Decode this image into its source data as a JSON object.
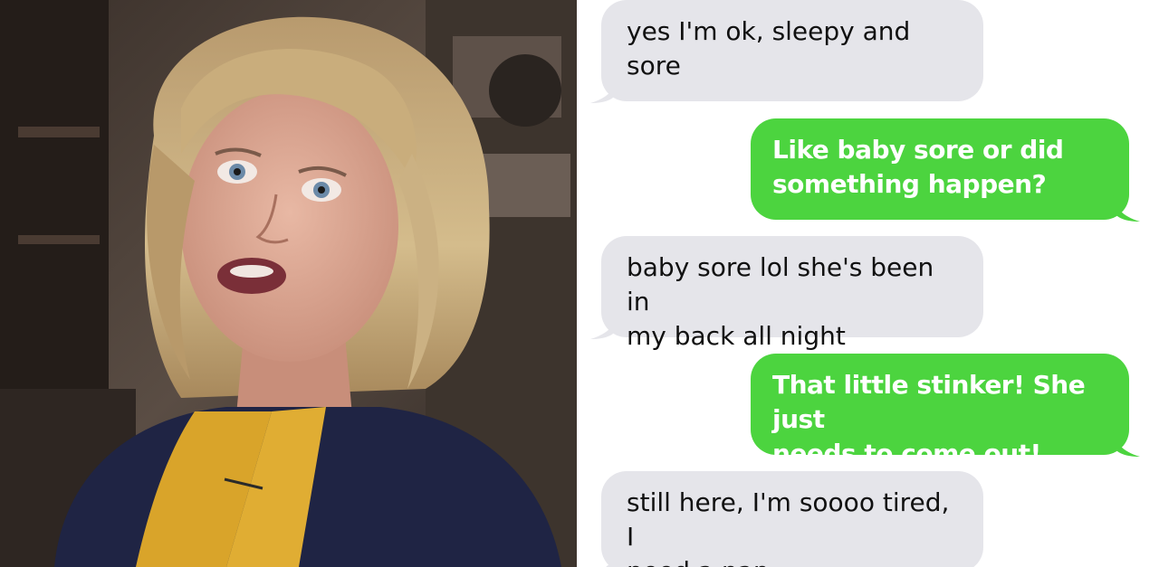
{
  "photo": {
    "subject": "woman-interview-photo"
  },
  "conversation": {
    "messages": [
      {
        "sender": "incoming",
        "text": "yes I'm ok, sleepy and\nsore"
      },
      {
        "sender": "outgoing",
        "text": "Like baby sore or did\nsomething happen?"
      },
      {
        "sender": "incoming",
        "text": "baby sore lol she's been in\nmy back all night"
      },
      {
        "sender": "outgoing",
        "text": "That little stinker! She just\nneeds to come out!"
      },
      {
        "sender": "incoming",
        "text": "still here, I'm soooo tired, I\nneed a nap"
      }
    ]
  },
  "colors": {
    "incoming_bubble": "#e5e5ea",
    "outgoing_bubble": "#4cd43f",
    "incoming_text": "#111111",
    "outgoing_text": "#ffffff"
  }
}
